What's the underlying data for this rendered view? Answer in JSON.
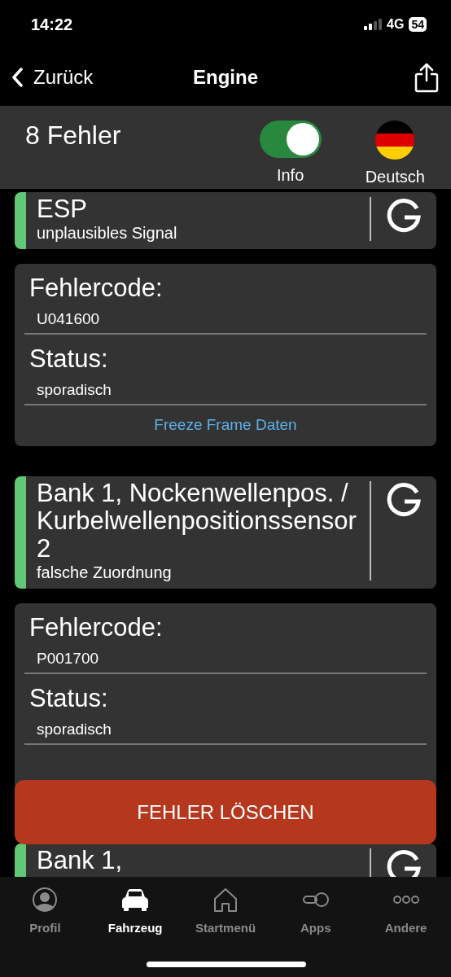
{
  "status_bar": {
    "time": "14:22",
    "network": "4G",
    "battery": "54"
  },
  "nav": {
    "back": "Zurück",
    "title": "Engine"
  },
  "header": {
    "count": "8 Fehler",
    "toggle": {
      "label": "Info",
      "on": true
    },
    "language": "Deutsch"
  },
  "faults": [
    {
      "title": "ESP",
      "subtitle": "unplausibles Signal",
      "details": {
        "code_label": "Fehlercode:",
        "code": "U041600",
        "status_label": "Status:",
        "status": "sporadisch",
        "link": "Freeze Frame Daten"
      }
    },
    {
      "title": "Bank 1, Nockenwellenpos. / Kurbelwellenpositionssensor 2",
      "subtitle": "falsche Zuordnung",
      "details": {
        "code_label": "Fehlercode:",
        "code": "P001700",
        "status_label": "Status:",
        "status": "sporadisch"
      }
    },
    {
      "title": "Bank 1,"
    }
  ],
  "action_button": "FEHLER LÖSCHEN",
  "tab_bar": [
    {
      "label": "Profil",
      "kind": "profile",
      "selected": false
    },
    {
      "label": "Fahrzeug",
      "kind": "car",
      "selected": true
    },
    {
      "label": "Startmenü",
      "kind": "home",
      "selected": false
    },
    {
      "label": "Apps",
      "kind": "apps",
      "selected": false
    },
    {
      "label": "Andere",
      "kind": "more",
      "selected": false
    }
  ]
}
